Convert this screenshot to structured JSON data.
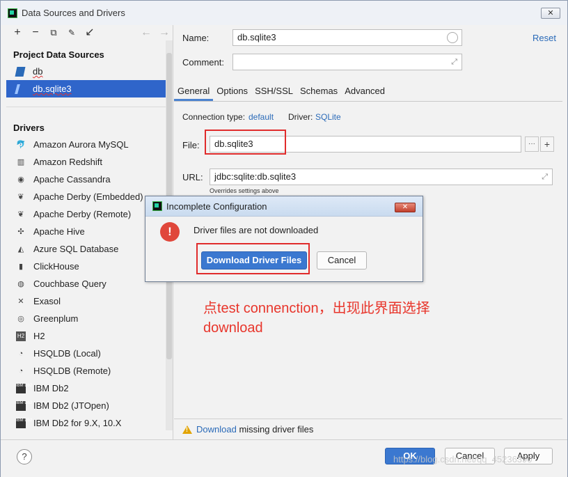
{
  "window": {
    "title": "Data Sources and Drivers",
    "close_icon": "close-icon"
  },
  "sidebar": {
    "toolbar": {
      "add": "+",
      "remove": "−",
      "duplicate": "⧉",
      "settings": "🔧",
      "import": "↙",
      "back": "←",
      "forward": "→"
    },
    "project_section_label": "Project Data Sources",
    "project_items": [
      {
        "label": "db",
        "icon": "database-icon"
      },
      {
        "label": "db.sqlite3",
        "icon": "database-icon",
        "selected": true
      }
    ],
    "drivers_section_label": "Drivers",
    "drivers": [
      {
        "label": "Amazon Aurora MySQL",
        "icon": "dolphin-icon"
      },
      {
        "label": "Amazon Redshift",
        "icon": "redshift-icon"
      },
      {
        "label": "Apache Cassandra",
        "icon": "eye-icon"
      },
      {
        "label": "Apache Derby (Embedded)",
        "icon": "feather-icon"
      },
      {
        "label": "Apache Derby (Remote)",
        "icon": "feather-icon"
      },
      {
        "label": "Apache Hive",
        "icon": "bee-icon"
      },
      {
        "label": "Azure SQL Database",
        "icon": "azure-icon"
      },
      {
        "label": "ClickHouse",
        "icon": "clickhouse-icon"
      },
      {
        "label": "Couchbase Query",
        "icon": "couchbase-icon"
      },
      {
        "label": "Exasol",
        "icon": "x-icon"
      },
      {
        "label": "Greenplum",
        "icon": "greenplum-icon"
      },
      {
        "label": "H2",
        "icon": "h2-icon"
      },
      {
        "label": "HSQLDB (Local)",
        "icon": "hsqldb-icon"
      },
      {
        "label": "HSQLDB (Remote)",
        "icon": "hsqldb-icon"
      },
      {
        "label": "IBM Db2",
        "icon": "ibm-icon"
      },
      {
        "label": "IBM Db2 (JTOpen)",
        "icon": "ibm-icon"
      },
      {
        "label": "IBM Db2 for 9.X, 10.X",
        "icon": "ibm-icon"
      }
    ]
  },
  "main": {
    "name_label": "Name:",
    "name_value": "db.sqlite3",
    "comment_label": "Comment:",
    "comment_value": "",
    "reset_link": "Reset",
    "tabs": [
      {
        "label": "General",
        "active": true
      },
      {
        "label": "Options"
      },
      {
        "label": "SSH/SSL"
      },
      {
        "label": "Schemas"
      },
      {
        "label": "Advanced"
      }
    ],
    "connection_type_label": "Connection type:",
    "connection_type_value": "default",
    "driver_label": "Driver:",
    "driver_value": "SQLite",
    "file_label": "File:",
    "file_value": "db.sqlite3",
    "file_browse": "···",
    "file_add": "+",
    "url_label": "URL:",
    "url_value": "jdbc:sqlite:db.sqlite3",
    "overrides_note": "Overrides settings above",
    "status_link": "Download",
    "status_text": " missing driver files"
  },
  "popup": {
    "title": "Incomplete Configuration",
    "message": "Driver files are not downloaded",
    "primary_button": "Download Driver Files",
    "cancel_button": "Cancel"
  },
  "footer": {
    "help": "?",
    "ok": "OK",
    "cancel": "Cancel",
    "apply": "Apply"
  },
  "annotation": "点test connenction，出现此界面选择download",
  "watermark": "https://blog.csdn.net/qq_45236390",
  "colors": {
    "accent": "#2f65ca",
    "annotation_red": "#e8352b",
    "link": "#2a6ab8"
  }
}
